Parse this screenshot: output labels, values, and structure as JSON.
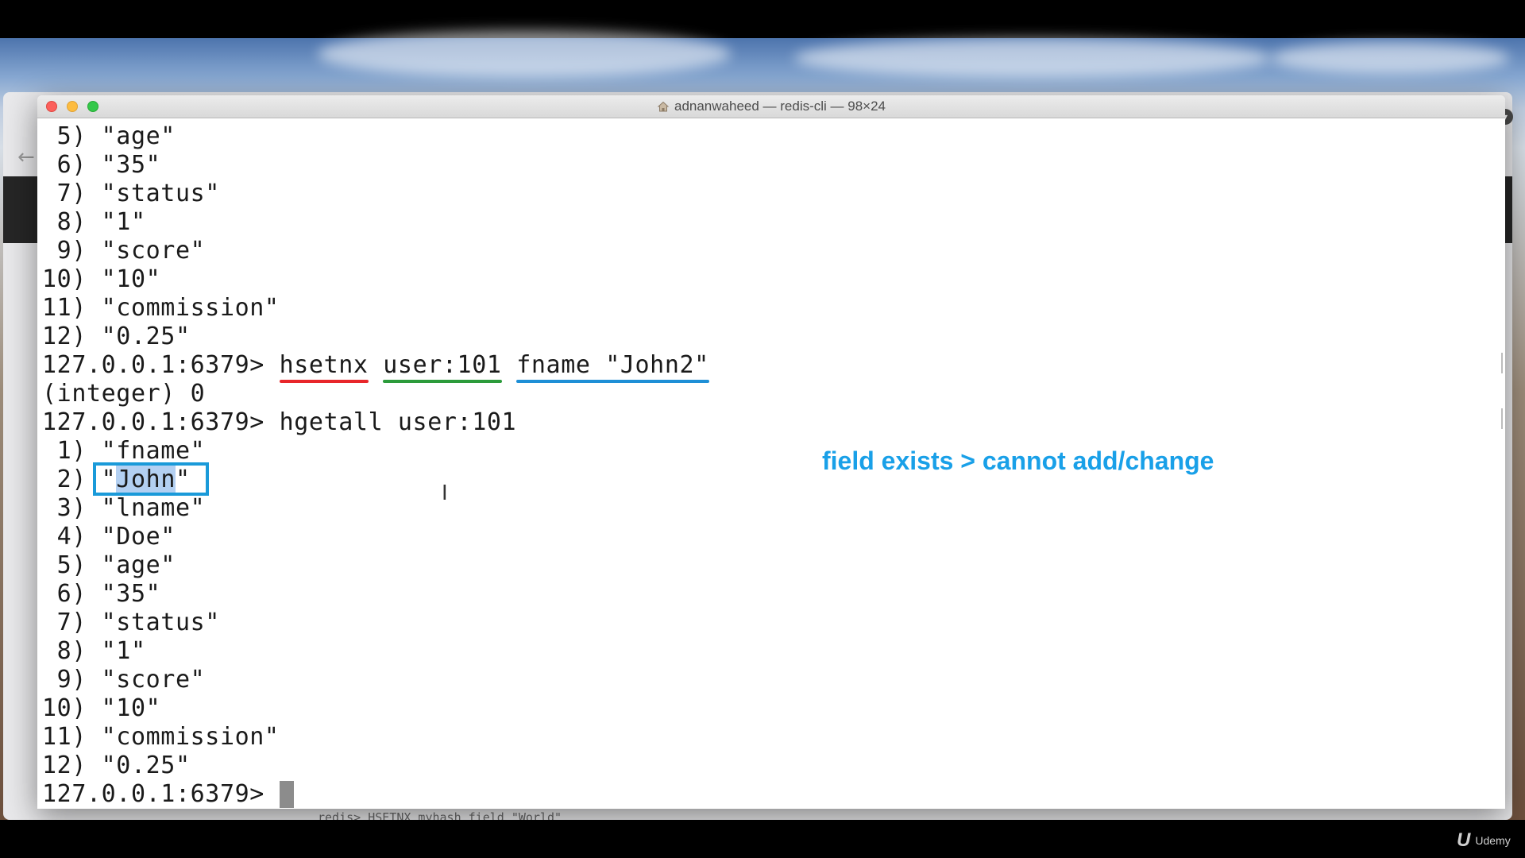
{
  "window": {
    "title": "adnanwaheed — redis-cli — 98×24"
  },
  "terminal": {
    "top_lines": [
      " 5) \"age\"",
      " 6) \"35\"",
      " 7) \"status\"",
      " 8) \"1\"",
      " 9) \"score\"",
      "10) \"10\"",
      "11) \"commission\"",
      "12) \"0.25\""
    ],
    "prompt": "127.0.0.1:6379> ",
    "cmd1": {
      "name": "hsetnx",
      "key": "user:101",
      "field_value": "fname \"John2\""
    },
    "result1": "(integer) 0",
    "cmd2": "hgetall user:101",
    "result_line1": " 1) \"fname\"",
    "result_line2": {
      "prefix": " 2) ",
      "q_open": "\"",
      "value": "John",
      "q_close": "\""
    },
    "result_lines_rest": [
      " 3) \"lname\"",
      " 4) \"Doe\"",
      " 5) \"age\"",
      " 6) \"35\"",
      " 7) \"status\"",
      " 8) \"1\"",
      " 9) \"score\"",
      "10) \"10\"",
      "11) \"commission\"",
      "12) \"0.25\""
    ],
    "final_prompt": "127.0.0.1:6379> "
  },
  "annotation": "field exists > cannot add/change",
  "background_command": "redis> HSETNX myhash field \"World\"",
  "branding": {
    "logo": "Udemy"
  },
  "colors": {
    "underline_command": "#e8262a",
    "underline_key": "#2c9b3b",
    "underline_field_value": "#1e8fd6",
    "annotation": "#19a0e8",
    "highlight_box": "#1a9ad9"
  }
}
